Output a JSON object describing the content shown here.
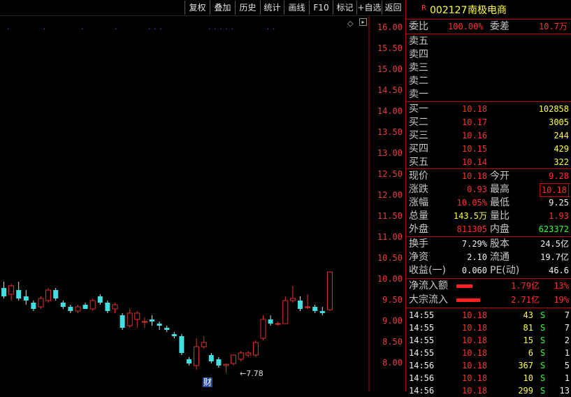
{
  "toolbar": {
    "buttons": [
      "复权",
      "叠加",
      "历史",
      "统计",
      "画线",
      "F10",
      "标记",
      "+自选",
      "返回"
    ]
  },
  "chart": {
    "y_ticks": [
      "16.00",
      "15.50",
      "15.00",
      "14.50",
      "14.00",
      "13.50",
      "13.00",
      "12.50",
      "12.00",
      "11.50",
      "11.00",
      "10.50",
      "10.00",
      "9.50",
      "9.00",
      "8.50",
      "8.00"
    ],
    "low_label": "←7.78",
    "finance_marker": "财",
    "up_color": "#e03030",
    "down_color": "#40e0e0"
  },
  "chart_data": {
    "type": "candlestick",
    "ylim": [
      7.7,
      16.2
    ],
    "candles": [
      {
        "o": 9.8,
        "h": 9.95,
        "l": 9.55,
        "c": 9.6
      },
      {
        "o": 9.65,
        "h": 9.9,
        "l": 9.5,
        "c": 9.85
      },
      {
        "o": 9.75,
        "h": 9.95,
        "l": 9.5,
        "c": 9.55
      },
      {
        "o": 9.6,
        "h": 9.75,
        "l": 9.4,
        "c": 9.5
      },
      {
        "o": 9.45,
        "h": 9.5,
        "l": 9.25,
        "c": 9.3
      },
      {
        "o": 9.35,
        "h": 9.6,
        "l": 9.3,
        "c": 9.55
      },
      {
        "o": 9.5,
        "h": 9.8,
        "l": 9.45,
        "c": 9.75
      },
      {
        "o": 9.75,
        "h": 9.8,
        "l": 9.5,
        "c": 9.55
      },
      {
        "o": 9.45,
        "h": 9.5,
        "l": 9.3,
        "c": 9.35
      },
      {
        "o": 9.35,
        "h": 9.4,
        "l": 9.2,
        "c": 9.25
      },
      {
        "o": 9.25,
        "h": 9.4,
        "l": 9.2,
        "c": 9.35
      },
      {
        "o": 9.4,
        "h": 9.45,
        "l": 9.3,
        "c": 9.3
      },
      {
        "o": 9.3,
        "h": 9.55,
        "l": 9.25,
        "c": 9.5
      },
      {
        "o": 9.6,
        "h": 9.65,
        "l": 9.4,
        "c": 9.45
      },
      {
        "o": 9.45,
        "h": 9.5,
        "l": 9.2,
        "c": 9.25
      },
      {
        "o": 9.3,
        "h": 9.45,
        "l": 9.2,
        "c": 9.4
      },
      {
        "o": 9.15,
        "h": 9.2,
        "l": 8.8,
        "c": 8.85
      },
      {
        "o": 8.9,
        "h": 9.3,
        "l": 8.85,
        "c": 9.2
      },
      {
        "o": 9.05,
        "h": 9.25,
        "l": 8.85,
        "c": 9.2
      },
      {
        "o": 9.0,
        "h": 9.1,
        "l": 8.85,
        "c": 9.0
      },
      {
        "o": 9.05,
        "h": 9.15,
        "l": 8.9,
        "c": 9.0
      },
      {
        "o": 8.95,
        "h": 9.0,
        "l": 8.8,
        "c": 8.9
      },
      {
        "o": 8.85,
        "h": 8.9,
        "l": 8.75,
        "c": 8.8
      },
      {
        "o": 8.7,
        "h": 8.75,
        "l": 8.6,
        "c": 8.65
      },
      {
        "o": 8.65,
        "h": 8.7,
        "l": 8.2,
        "c": 8.25
      },
      {
        "o": 8.1,
        "h": 8.15,
        "l": 7.95,
        "c": 8.0
      },
      {
        "o": 7.95,
        "h": 8.6,
        "l": 7.85,
        "c": 8.4
      },
      {
        "o": 8.4,
        "h": 8.65,
        "l": 8.35,
        "c": 8.5
      },
      {
        "o": 8.2,
        "h": 8.25,
        "l": 8.0,
        "c": 8.05
      },
      {
        "o": 8.1,
        "h": 8.15,
        "l": 7.9,
        "c": 7.95
      },
      {
        "o": 7.95,
        "h": 8.0,
        "l": 7.78,
        "c": 7.98
      },
      {
        "o": 8.0,
        "h": 8.2,
        "l": 7.95,
        "c": 8.2
      },
      {
        "o": 8.1,
        "h": 8.3,
        "l": 8.05,
        "c": 8.25
      },
      {
        "o": 8.2,
        "h": 8.3,
        "l": 8.15,
        "c": 8.25
      },
      {
        "o": 8.2,
        "h": 8.55,
        "l": 8.15,
        "c": 8.5
      },
      {
        "o": 8.6,
        "h": 9.15,
        "l": 8.55,
        "c": 9.05
      },
      {
        "o": 9.05,
        "h": 9.15,
        "l": 8.9,
        "c": 8.95
      },
      {
        "o": 8.95,
        "h": 9.0,
        "l": 8.9,
        "c": 8.95
      },
      {
        "o": 8.95,
        "h": 9.6,
        "l": 8.95,
        "c": 9.5
      },
      {
        "o": 9.5,
        "h": 9.85,
        "l": 9.45,
        "c": 9.55
      },
      {
        "o": 9.5,
        "h": 9.6,
        "l": 9.25,
        "c": 9.3
      },
      {
        "o": 9.35,
        "h": 9.65,
        "l": 9.3,
        "c": 9.35
      },
      {
        "o": 9.35,
        "h": 9.4,
        "l": 9.2,
        "c": 9.25
      },
      {
        "o": 9.25,
        "h": 9.35,
        "l": 9.15,
        "c": 9.2
      },
      {
        "o": 9.28,
        "h": 10.18,
        "l": 9.25,
        "c": 10.18
      }
    ]
  },
  "panel": {
    "flag": "R",
    "code": "002127",
    "name": "南极电商",
    "weibi_label": "委比",
    "weibi": "100.00%",
    "weicha_label": "委差",
    "weicha": "10.7万",
    "sell": [
      {
        "label": "卖五"
      },
      {
        "label": "卖四"
      },
      {
        "label": "卖三"
      },
      {
        "label": "卖二"
      },
      {
        "label": "卖一"
      }
    ],
    "buy": [
      {
        "label": "买一",
        "price": "10.18",
        "vol": "102858"
      },
      {
        "label": "买二",
        "price": "10.17",
        "vol": "3005"
      },
      {
        "label": "买三",
        "price": "10.16",
        "vol": "244"
      },
      {
        "label": "买四",
        "price": "10.15",
        "vol": "429"
      },
      {
        "label": "买五",
        "price": "10.14",
        "vol": "322"
      }
    ],
    "quote": [
      {
        "l1": "现价",
        "v1": "10.18",
        "l2": "今开",
        "v2": "9.28"
      },
      {
        "l1": "涨跌",
        "v1": "0.93",
        "l2": "最高",
        "v2": "10.18"
      },
      {
        "l1": "涨幅",
        "v1": "10.05%",
        "l2": "最低",
        "v2": "9.25"
      },
      {
        "l1": "总量",
        "v1": "143.5万",
        "l2": "量比",
        "v2": "1.93"
      },
      {
        "l1": "外盘",
        "v1": "811305",
        "l2": "内盘",
        "v2": "623372"
      }
    ],
    "fund": [
      {
        "l1": "换手",
        "v1": "7.29%",
        "l2": "股本",
        "v2": "24.5亿"
      },
      {
        "l1": "净资",
        "v1": "2.10",
        "l2": "流通",
        "v2": "19.7亿"
      },
      {
        "l1": "收益(一)",
        "v1": "0.060",
        "l2": "PE(动)",
        "v2": "46.6"
      }
    ],
    "flow": [
      {
        "label": "净流入额",
        "value": "1.79亿",
        "pct": "13%",
        "bar_fraction": 0.13
      },
      {
        "label": "大宗流入",
        "value": "2.71亿",
        "pct": "19%",
        "bar_fraction": 0.19
      }
    ],
    "ticks": [
      {
        "time": "14:55",
        "price": "10.18",
        "vol": "43",
        "side": "S",
        "n": "7"
      },
      {
        "time": "14:55",
        "price": "10.18",
        "vol": "81",
        "side": "S",
        "n": "7"
      },
      {
        "time": "14:55",
        "price": "10.18",
        "vol": "15",
        "side": "S",
        "n": "2"
      },
      {
        "time": "14:55",
        "price": "10.18",
        "vol": "6",
        "side": "S",
        "n": "1"
      },
      {
        "time": "14:56",
        "price": "10.18",
        "vol": "367",
        "side": "S",
        "n": "5"
      },
      {
        "time": "14:56",
        "price": "10.18",
        "vol": "10",
        "side": "S",
        "n": "1"
      },
      {
        "time": "14:56",
        "price": "10.18",
        "vol": "299",
        "side": "S",
        "n": "13"
      }
    ]
  }
}
